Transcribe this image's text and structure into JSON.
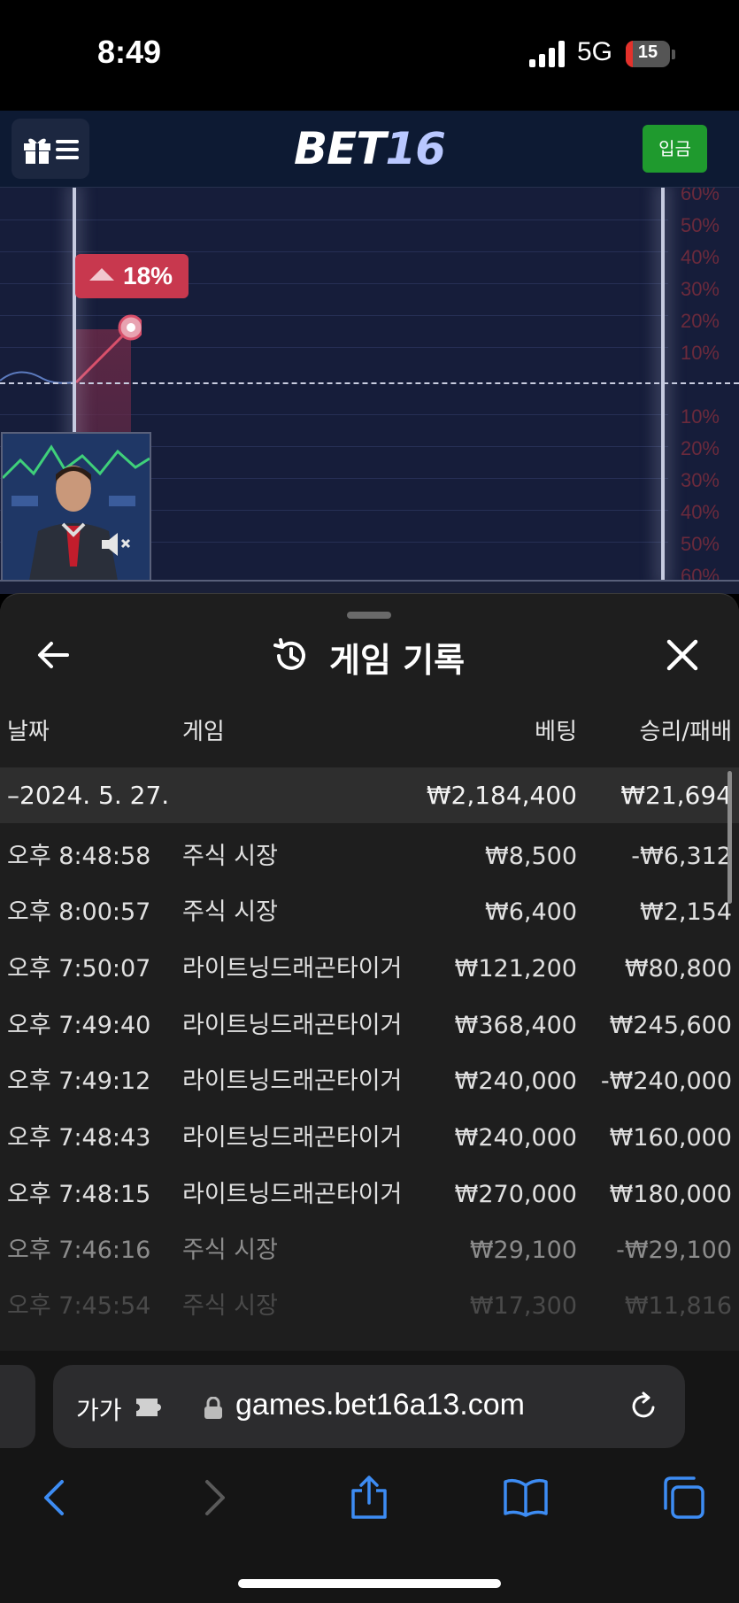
{
  "status_bar": {
    "time": "8:49",
    "network": "5G",
    "battery": "15"
  },
  "header": {
    "logo_part1": "BET",
    "logo_part2": "16",
    "deposit_label": "입금"
  },
  "chart": {
    "badge": "18%",
    "percent_labels_up": [
      "60%",
      "50%",
      "40%",
      "30%",
      "20%",
      "10%"
    ],
    "percent_labels_down": [
      "10%",
      "20%",
      "30%",
      "40%",
      "50%",
      "60%"
    ]
  },
  "history": {
    "title": "게임 기록",
    "columns": {
      "date": "날짜",
      "game": "게임",
      "bet": "베팅",
      "result": "승리/패배"
    },
    "summary": {
      "date": "–2024. 5. 27.",
      "bet": "₩2,184,400",
      "result": "₩21,694"
    },
    "rows": [
      {
        "time": "오후 8:48:58",
        "game": "주식 시장",
        "bet": "₩8,500",
        "result": "-₩6,312"
      },
      {
        "time": "오후 8:00:57",
        "game": "주식 시장",
        "bet": "₩6,400",
        "result": "₩2,154"
      },
      {
        "time": "오후 7:50:07",
        "game": "라이트닝드래곤타이거",
        "bet": "₩121,200",
        "result": "₩80,800"
      },
      {
        "time": "오후 7:49:40",
        "game": "라이트닝드래곤타이거",
        "bet": "₩368,400",
        "result": "₩245,600"
      },
      {
        "time": "오후 7:49:12",
        "game": "라이트닝드래곤타이거",
        "bet": "₩240,000",
        "result": "-₩240,000"
      },
      {
        "time": "오후 7:48:43",
        "game": "라이트닝드래곤타이거",
        "bet": "₩240,000",
        "result": "₩160,000"
      },
      {
        "time": "오후 7:48:15",
        "game": "라이트닝드래곤타이거",
        "bet": "₩270,000",
        "result": "₩180,000"
      },
      {
        "time": "오후 7:46:16",
        "game": "주식 시장",
        "bet": "₩29,100",
        "result": "-₩29,100"
      },
      {
        "time": "오후 7:45:54",
        "game": "주식 시장",
        "bet": "₩17,300",
        "result": "₩11,816"
      }
    ]
  },
  "browser": {
    "aa_label": "가가",
    "url": "games.bet16a13.com"
  }
}
